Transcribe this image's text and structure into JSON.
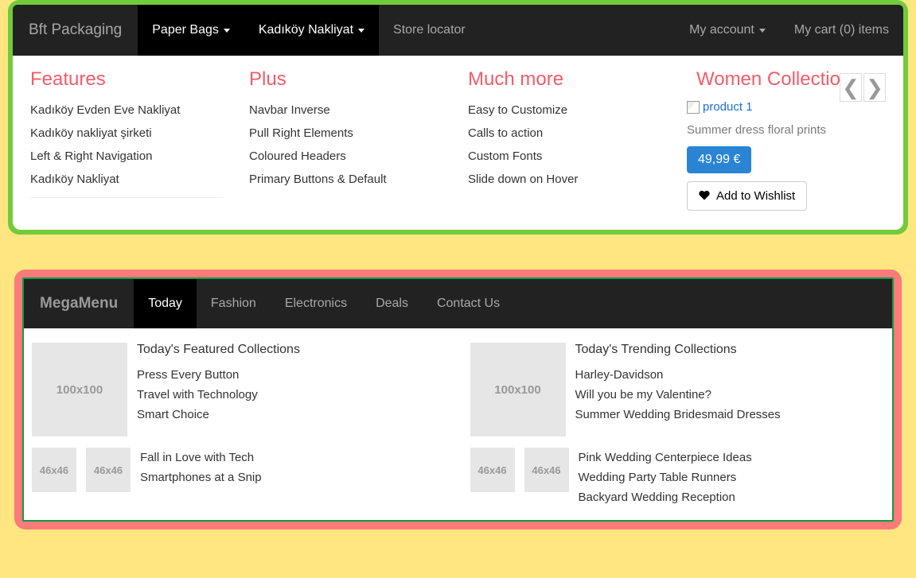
{
  "nav1": {
    "brand": "Bft Packaging",
    "items": [
      "Paper Bags",
      "Kadıköy Nakliyat",
      "Store locator"
    ],
    "right": {
      "account": "My account",
      "cart_prefix": "My cart (",
      "cart_count": "0",
      "cart_suffix": ") items"
    }
  },
  "mega1": {
    "features": {
      "title": "Features",
      "items": [
        "Kadıköy Evden Eve Nakliyat",
        "Kadıköy nakliyat şirketi",
        "Left & Right Navigation",
        "Kadıköy Nakliyat"
      ]
    },
    "plus": {
      "title": "Plus",
      "items": [
        "Navbar Inverse",
        "Pull Right Elements",
        "Coloured Headers",
        "Primary Buttons & Default"
      ]
    },
    "more": {
      "title": "Much more",
      "items": [
        "Easy to Customize",
        "Calls to action",
        "Custom Fonts",
        "Slide down on Hover"
      ]
    },
    "product": {
      "title": "Women Collection",
      "img_alt": "product 1",
      "desc": "Summer dress floral prints",
      "price": "49,99 €",
      "wishlist": "Add to Wishlist"
    }
  },
  "nav2": {
    "brand": "MegaMenu",
    "items": [
      "Today",
      "Fashion",
      "Electronics",
      "Deals",
      "Contact Us"
    ]
  },
  "mega2": {
    "thumb100": "100x100",
    "thumb46": "46x46",
    "left": {
      "h1": "Today's Featured Collections",
      "top_items": [
        "Press Every Button",
        "Travel with Technology",
        "Smart Choice"
      ],
      "bottom_items": [
        "Fall in Love with Tech",
        "Smartphones at a Snip"
      ]
    },
    "right": {
      "h1": "Today's Trending Collections",
      "top_items": [
        "Harley-Davidson",
        "Will you be my Valentine?",
        "Summer Wedding Bridesmaid Dresses"
      ],
      "bottom_items": [
        "Pink Wedding Centerpiece Ideas",
        "Wedding Party Table Runners",
        "Backyard Wedding Reception"
      ]
    }
  }
}
